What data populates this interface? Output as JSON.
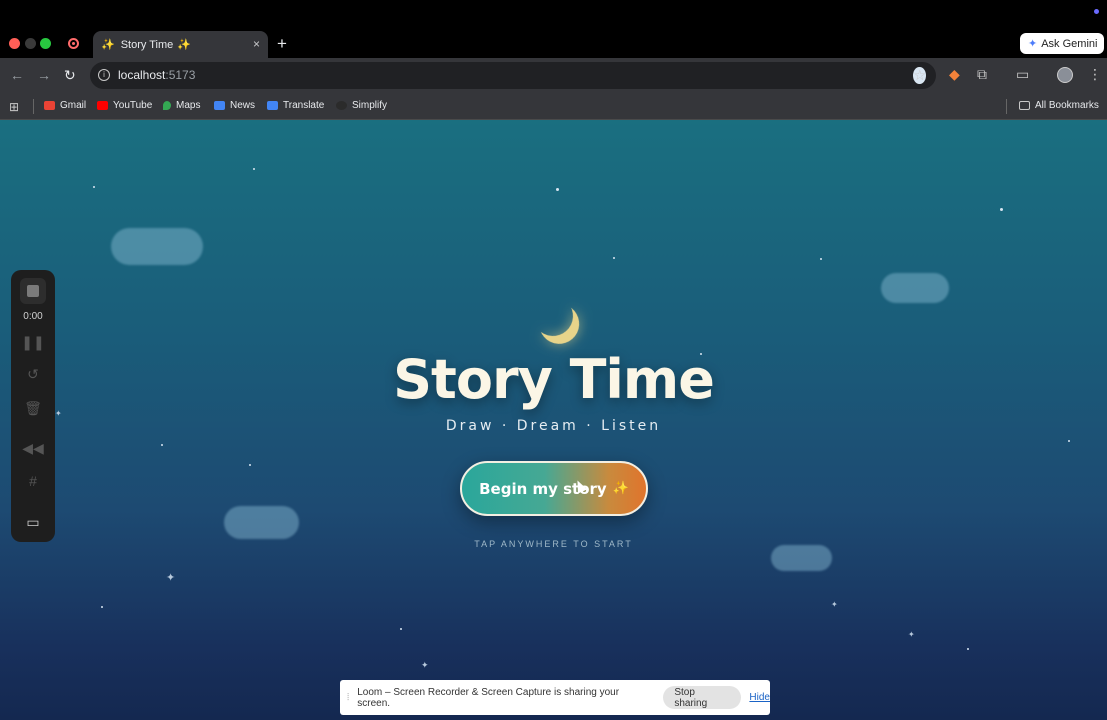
{
  "browser": {
    "tab_title": "Story Time",
    "tab_favicon": "✨",
    "tab_title_sparkle": "✨",
    "new_tab": "+",
    "close": "×",
    "ask_gemini": "Ask Gemini",
    "url_host": "localhost",
    "url_port": ":5173",
    "bookmarks": [
      {
        "label": "Gmail",
        "color": "#ea4335"
      },
      {
        "label": "YouTube",
        "color": "#ff0000"
      },
      {
        "label": "Maps",
        "color": "#34a853"
      },
      {
        "label": "News",
        "color": "#4285f4"
      },
      {
        "label": "Translate",
        "color": "#4285f4"
      },
      {
        "label": "Simplify",
        "color": "#2b2b2b"
      }
    ],
    "all_bookmarks": "All Bookmarks"
  },
  "page": {
    "title": "Story Time",
    "subtitle": "Draw · Dream · Listen",
    "cta_label": "Begin my story",
    "cta_sparkle": "✨",
    "hint": "TAP ANYWHERE TO START",
    "background_colors": [
      "#1a6f80",
      "#1d4a72",
      "#142850"
    ],
    "moon_color": "#e8d48a"
  },
  "loom_panel": {
    "timer": "0:00",
    "icons": [
      "stop-icon",
      "pause-icon",
      "restart-icon",
      "trash-icon",
      "rewind-icon",
      "grid-icon",
      "camera-icon"
    ]
  },
  "share_banner": {
    "message": "Loom – Screen Recorder & Screen Capture is sharing your screen.",
    "stop_label": "Stop sharing",
    "hide_label": "Hide"
  }
}
